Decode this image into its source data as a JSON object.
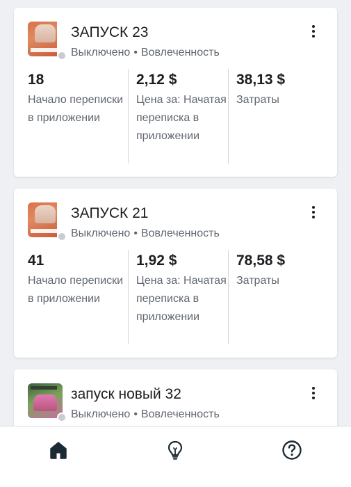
{
  "campaigns": [
    {
      "title": "ЗАПУСК 23",
      "status": "Выключено",
      "separator": "•",
      "objective": "Вовлеченность",
      "status_color": "#c7ccd1",
      "metrics": [
        {
          "value": "18",
          "label": "Начало переписки в приложении"
        },
        {
          "value": "2,12 $",
          "label": "Цена за: Начатая переписка в приложении"
        },
        {
          "value": "38,13 $",
          "label": "Затраты"
        }
      ]
    },
    {
      "title": "ЗАПУСК 21",
      "status": "Выключено",
      "separator": "•",
      "objective": "Вовлеченность",
      "status_color": "#c7ccd1",
      "metrics": [
        {
          "value": "41",
          "label": "Начало переписки в приложении"
        },
        {
          "value": "1,92 $",
          "label": "Цена за: Начатая переписка в приложении"
        },
        {
          "value": "78,58 $",
          "label": "Затраты"
        }
      ]
    },
    {
      "title": "запуск новый 32",
      "status": "Выключено",
      "separator": "•",
      "objective": "Вовлеченность",
      "status_color": "#c7ccd1"
    }
  ],
  "tabbar": {
    "items": [
      {
        "icon": "home-icon",
        "active": true
      },
      {
        "icon": "lightbulb-icon",
        "active": false
      },
      {
        "icon": "help-icon",
        "active": false
      }
    ],
    "icon_color": "#1c2b33"
  },
  "colors": {
    "text_primary": "#1c1e21",
    "text_secondary": "#606770",
    "background": "#eef0f3",
    "card": "#ffffff"
  }
}
